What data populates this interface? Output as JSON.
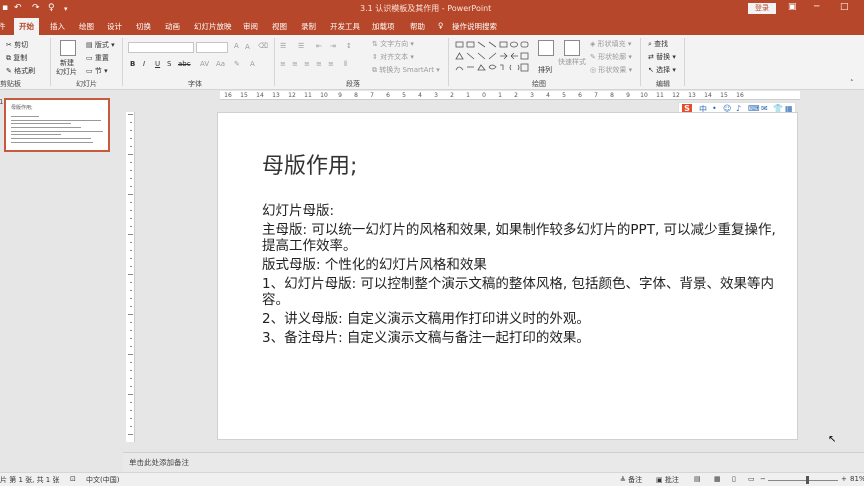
{
  "titlebar": {
    "title": "3.1 认识模板及其作用 - PowerPoint",
    "login_label": "登录",
    "quick_access": [
      "↶",
      "↷",
      "♀"
    ]
  },
  "ribbon_tabs": [
    {
      "label": "件",
      "active": false
    },
    {
      "label": "开始",
      "active": true
    },
    {
      "label": "插入",
      "active": false
    },
    {
      "label": "绘图",
      "active": false
    },
    {
      "label": "设计",
      "active": false
    },
    {
      "label": "切换",
      "active": false
    },
    {
      "label": "动画",
      "active": false
    },
    {
      "label": "幻灯片放映",
      "active": false
    },
    {
      "label": "审阅",
      "active": false
    },
    {
      "label": "视图",
      "active": false
    },
    {
      "label": "录制",
      "active": false
    },
    {
      "label": "开发工具",
      "active": false
    },
    {
      "label": "加载项",
      "active": false
    },
    {
      "label": "帮助",
      "active": false
    }
  ],
  "search_label": "操作说明搜索",
  "clipboard": {
    "cut": "剪切",
    "copy": "复制",
    "format_painter": "格式刷",
    "group": "剪贴板"
  },
  "slides_group": {
    "new_slide": "新建",
    "new_slide2": "幻灯片",
    "layout": "版式",
    "reset": "重置",
    "section": "节",
    "group": "幻灯片"
  },
  "font_group": {
    "bold": "B",
    "italic": "I",
    "underline": "U",
    "shadow": "S",
    "strike": "abc",
    "group": "字体"
  },
  "paragraph_group": {
    "text_direction": "文字方向",
    "align_text": "对齐文本",
    "smartart": "转换为 SmartArt",
    "group": "段落"
  },
  "drawing_group": {
    "arrange": "排列",
    "quick_styles": "快速样式",
    "fill": "形状填充",
    "outline": "形状轮廓",
    "effects": "形状效果",
    "group": "绘图"
  },
  "editing_group": {
    "find": "查找",
    "replace": "替换",
    "select": "选择",
    "group": "编辑"
  },
  "thumbnail": {
    "number": "1",
    "title": "母版作用;"
  },
  "ruler_ticks": [
    "16",
    "15",
    "14",
    "13",
    "12",
    "11",
    "10",
    "9",
    "8",
    "7",
    "6",
    "5",
    "4",
    "3",
    "2",
    "1",
    "0",
    "1",
    "2",
    "3",
    "4",
    "5",
    "6",
    "7",
    "8",
    "9",
    "10",
    "11",
    "12",
    "13",
    "14",
    "15",
    "16"
  ],
  "ime_toolbar": {
    "logo": "S",
    "items": [
      "中",
      "•",
      "☺",
      "♪",
      "⌨",
      "✉",
      "👕",
      "▦"
    ]
  },
  "slide": {
    "title": "母版作用;",
    "paragraphs": [
      "幻灯片母版:",
      "主母版: 可以统一幻灯片的风格和效果, 如果制作较多幻灯片的PPT, 可以减少重复操作, 提高工作效率。",
      "版式母版: 个性化的幻灯片风格和效果",
      "1、幻灯片母版: 可以控制整个演示文稿的整体风格, 包括颜色、字体、背景、效果等内容。",
      "2、讲义母版: 自定义演示文稿用作打印讲义时的外观。",
      "3、备注母片: 自定义演示文稿与备注一起打印的效果。"
    ]
  },
  "notes_placeholder": "单击此处添加备注",
  "status": {
    "slide_info": "片 第 1 张, 共 1 张",
    "language": "中文(中国)",
    "notes": "备注",
    "comments": "批注",
    "zoom": "81%"
  },
  "colors": {
    "accent": "#b7472a",
    "ribbon_bg": "#f3f3f3",
    "thumb_border": "#c55a3c"
  }
}
